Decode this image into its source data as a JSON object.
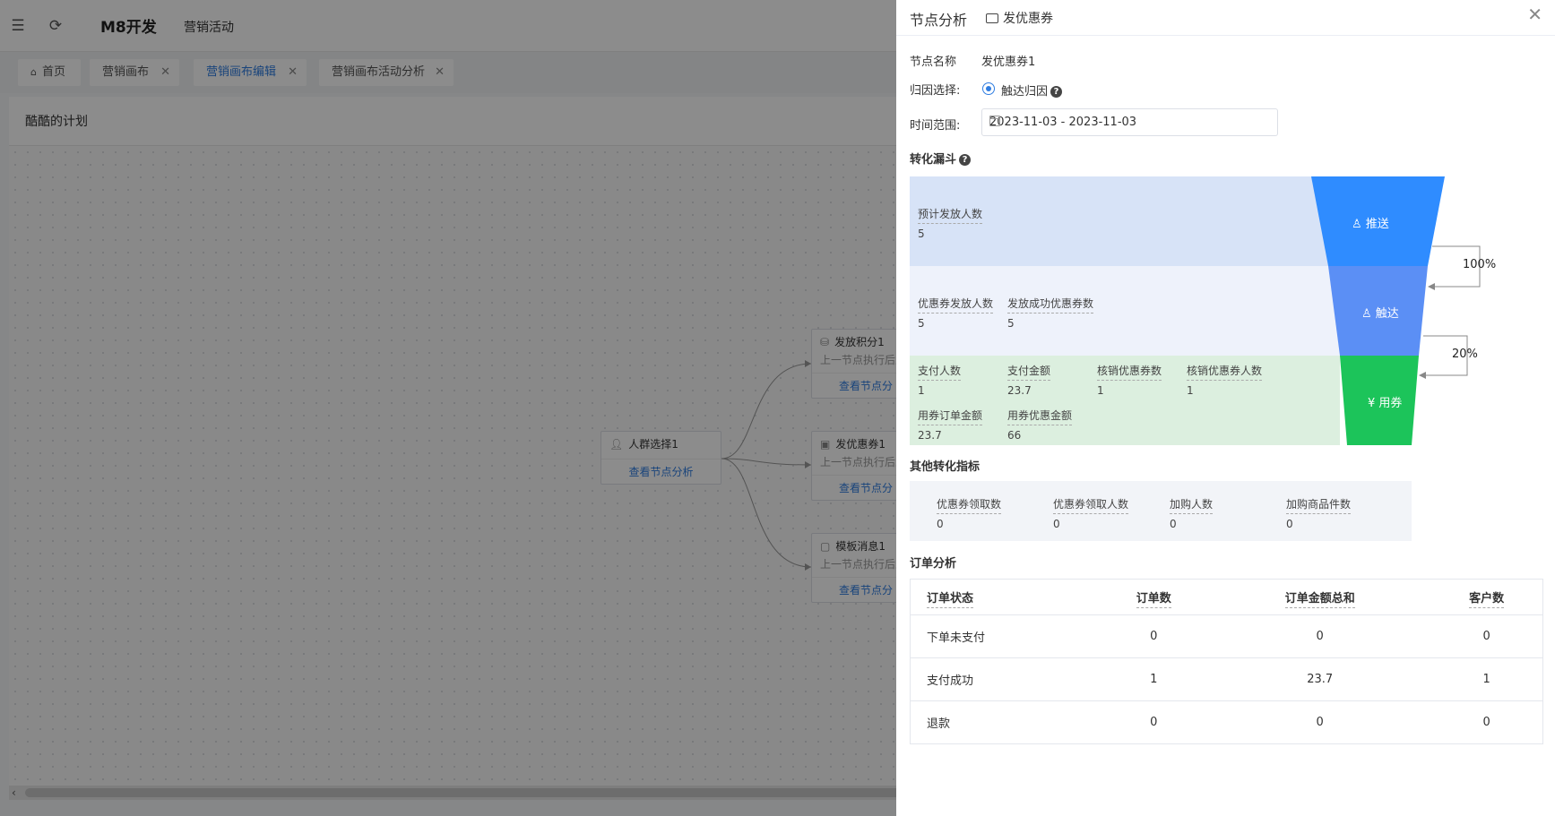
{
  "app": {
    "brand": "M8开发",
    "breadcrumb": "营销活动",
    "tabs": [
      {
        "label": "首页"
      },
      {
        "label": "营销画布"
      },
      {
        "label": "营销画布编辑"
      },
      {
        "label": "营销画布活动分析"
      }
    ],
    "plan_title": "酷酷的计划",
    "nodes": {
      "audience": {
        "title": "人群选择1",
        "link": "查看节点分析"
      },
      "points": {
        "title": "发放积分1",
        "subtitle": "上一节点执行后立",
        "link": "查看节点分"
      },
      "coupon": {
        "title": "发优惠券1",
        "subtitle": "上一节点执行后立",
        "link": "查看节点分"
      },
      "template": {
        "title": "模板消息1",
        "subtitle": "上一节点执行后立",
        "link": "查看节点分"
      }
    }
  },
  "drawer": {
    "title": "节点分析",
    "subtitle": "发优惠券",
    "node_name_label": "节点名称",
    "node_name_value": "发优惠券1",
    "attribution_label": "归因选择:",
    "attribution_value": "触达归因",
    "time_label": "时间范围:",
    "time_value": "2023-11-03 - 2023-11-03",
    "funnel": {
      "title": "转化漏斗",
      "stages": [
        {
          "label": "推送",
          "color": "#2f8cff"
        },
        {
          "label": "触达",
          "color": "#5b8ff5"
        },
        {
          "label": "用券",
          "color": "#1cc45a"
        }
      ],
      "rates": [
        "100%",
        "20%"
      ],
      "push_metrics": [
        {
          "name": "预计发放人数",
          "value": "5"
        }
      ],
      "reach_metrics": [
        {
          "name": "优惠券发放人数",
          "value": "5"
        },
        {
          "name": "发放成功优惠券数",
          "value": "5"
        }
      ],
      "use_metrics": [
        {
          "name": "支付人数",
          "value": "1"
        },
        {
          "name": "支付金额",
          "value": "23.7"
        },
        {
          "name": "核销优惠券数",
          "value": "1"
        },
        {
          "name": "核销优惠券人数",
          "value": "1"
        },
        {
          "name": "用券订单金额",
          "value": "23.7"
        },
        {
          "name": "用券优惠金额",
          "value": "66"
        }
      ]
    },
    "other": {
      "title": "其他转化指标",
      "metrics": [
        {
          "name": "优惠券领取数",
          "value": "0"
        },
        {
          "name": "优惠券领取人数",
          "value": "0"
        },
        {
          "name": "加购人数",
          "value": "0"
        },
        {
          "name": "加购商品件数",
          "value": "0"
        }
      ]
    },
    "orders": {
      "title": "订单分析",
      "headers": [
        "订单状态",
        "订单数",
        "订单金额总和",
        "客户数"
      ],
      "rows": [
        [
          "下单未支付",
          "0",
          "0",
          "0"
        ],
        [
          "支付成功",
          "1",
          "23.7",
          "1"
        ],
        [
          "退款",
          "0",
          "0",
          "0"
        ]
      ]
    }
  }
}
